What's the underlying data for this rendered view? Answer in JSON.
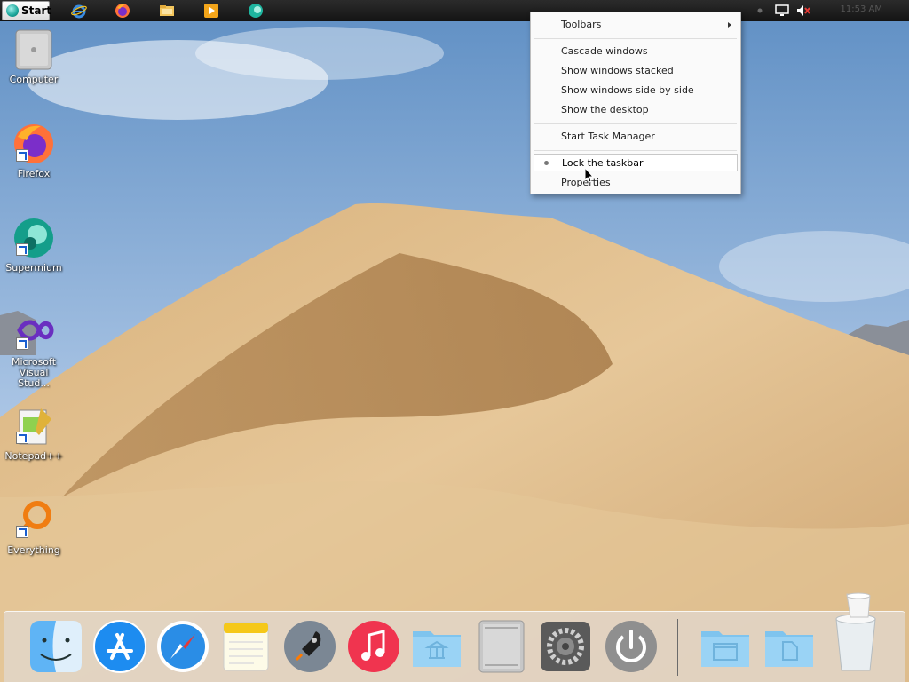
{
  "taskbar": {
    "start_label": "Start",
    "pinned": [
      {
        "icon": "internet-explorer-icon"
      },
      {
        "icon": "firefox-icon"
      },
      {
        "icon": "file-explorer-icon"
      },
      {
        "icon": "media-player-icon"
      },
      {
        "icon": "supermium-icon"
      }
    ],
    "tray": {
      "icons": [
        "notification-dot-icon",
        "network-icon",
        "volume-muted-icon"
      ],
      "clock": "11:53 AM"
    }
  },
  "desktop_icons": [
    {
      "label": "Computer",
      "icon": "computer-icon",
      "shortcut": false
    },
    {
      "label": "Firefox",
      "icon": "firefox-icon",
      "shortcut": true
    },
    {
      "label": "Supermium",
      "icon": "supermium-icon",
      "shortcut": true
    },
    {
      "label": "Microsoft Visual Stud...",
      "icon": "visual-studio-icon",
      "shortcut": true
    },
    {
      "label": "Notepad++",
      "icon": "notepad-plus-plus-icon",
      "shortcut": true
    },
    {
      "label": "Everything",
      "icon": "everything-search-icon",
      "shortcut": true
    }
  ],
  "context_menu": {
    "items": {
      "toolbars": "Toolbars",
      "cascade": "Cascade windows",
      "stacked": "Show windows stacked",
      "side_by_side": "Show windows side by side",
      "show_desktop": "Show the desktop",
      "task_manager": "Start Task Manager",
      "lock_taskbar": "Lock the taskbar",
      "properties": "Properties"
    },
    "lock_taskbar_checked": true
  },
  "dock": {
    "items": [
      {
        "icon": "finder-icon"
      },
      {
        "icon": "app-store-icon"
      },
      {
        "icon": "safari-icon"
      },
      {
        "icon": "notes-icon"
      },
      {
        "icon": "launchpad-icon"
      },
      {
        "icon": "itunes-icon"
      },
      {
        "icon": "applications-folder-icon"
      },
      {
        "icon": "mac-pro-icon"
      },
      {
        "icon": "system-preferences-icon"
      },
      {
        "icon": "shutdown-icon"
      },
      {
        "icon": "documents-folder-icon"
      },
      {
        "icon": "downloads-folder-icon"
      },
      {
        "icon": "trash-icon"
      }
    ]
  },
  "colors": {
    "sky_top": "#6e9ac9",
    "sky_bottom": "#bcd2ea",
    "sand_light": "#e2c296",
    "sand_dark": "#b58a57",
    "taskbar": "#1e1e1e",
    "menu_bg": "#fafafa"
  }
}
